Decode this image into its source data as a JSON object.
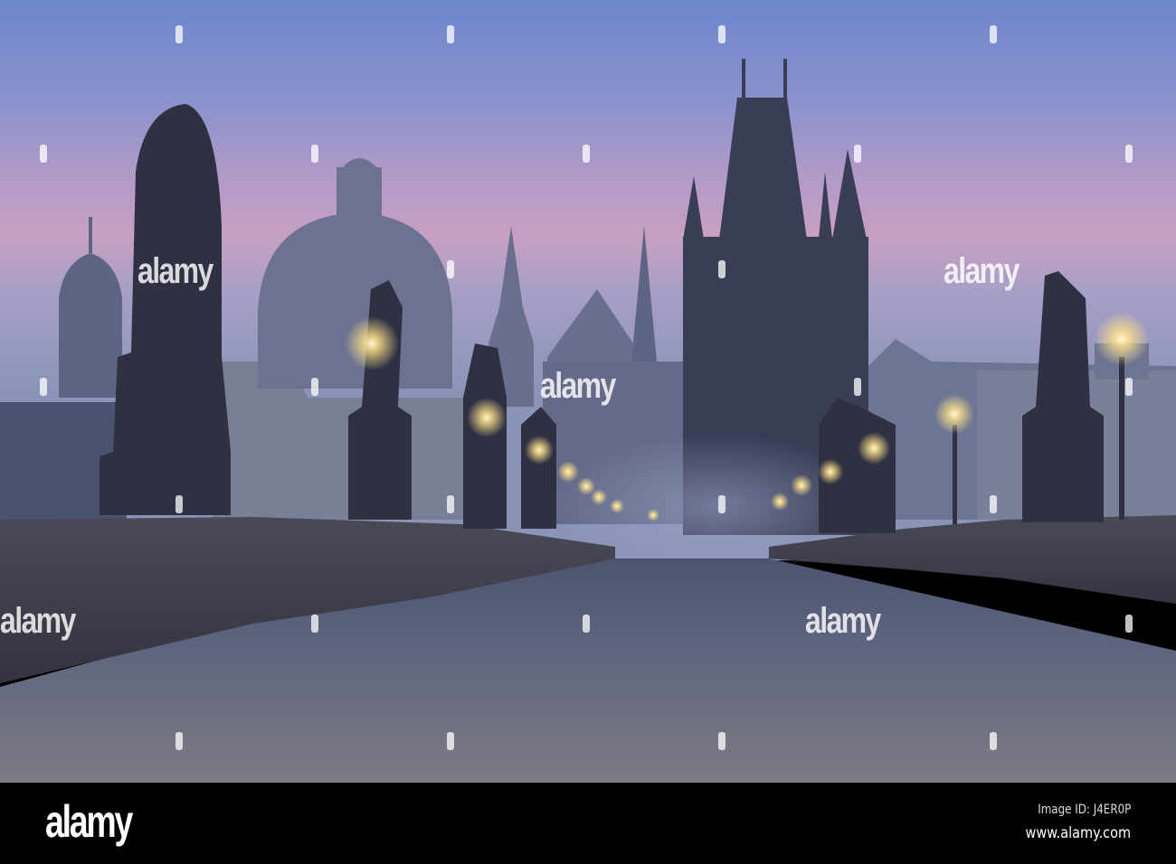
{
  "watermark": {
    "text": "alamy"
  },
  "footer": {
    "logo": "alamy",
    "image_id": "Image ID: J4ER0P",
    "url": "www.alamy.com"
  },
  "colors": {
    "sky_top": "#6d86cc",
    "sky_mid": "#a996c8",
    "sky_pink": "#c7a0c2",
    "silhouette": "#2f3142",
    "lamp": "#ffe9a0"
  }
}
